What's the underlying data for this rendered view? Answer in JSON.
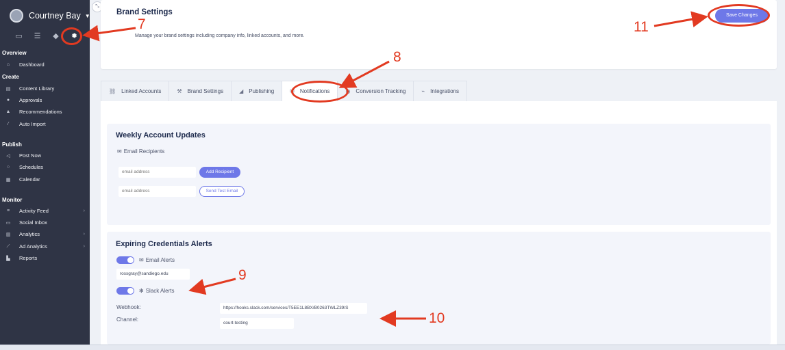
{
  "sidebar": {
    "profile_name": "Courtney Bay",
    "top_icons": [
      "monitor-icon",
      "list-icon",
      "bell-icon",
      "gear-icon"
    ],
    "sections": {
      "overview": "Overview",
      "create": "Create",
      "publish": "Publish",
      "monitor": "Monitor"
    },
    "items": {
      "dashboard": "Dashboard",
      "content_library": "Content Library",
      "approvals": "Approvals",
      "recommendations": "Recommendations",
      "auto_import": "Auto Import",
      "post_now": "Post Now",
      "schedules": "Schedules",
      "calendar": "Calendar",
      "activity_feed": "Activity Feed",
      "social_inbox": "Social Inbox",
      "analytics": "Analytics",
      "ad_analytics": "Ad Analytics",
      "reports": "Reports"
    }
  },
  "header": {
    "title": "Brand Settings",
    "subtitle": "Manage your brand settings including company info, linked accounts, and more.",
    "save_label": "Save Changes"
  },
  "tabs": {
    "linked_accounts": "Linked Accounts",
    "brand_settings": "Brand Settings",
    "publishing": "Publishing",
    "notifications": "Notifications",
    "conversion_tracking": "Conversion Tracking",
    "integrations": "Integrations",
    "active": "Notifications"
  },
  "weekly": {
    "title": "Weekly Account Updates",
    "recipients_label": "Email Recipients",
    "email_placeholder_1": "email address",
    "email_placeholder_2": "email address",
    "add_recipient": "Add Recipient",
    "send_test": "Send Test Email"
  },
  "expiring": {
    "title": "Expiring Credentials Alerts",
    "email_alerts_label": "Email Alerts",
    "email_alerts_on": true,
    "email_value": "rossgray@sandiego.edu",
    "slack_alerts_label": "Slack Alerts",
    "slack_alerts_on": true,
    "webhook_label": "Webhook:",
    "webhook_value": "https://hooks.slack.com/services/T5EE1L8BX/B0263TWLZ39/S",
    "channel_label": "Channel:",
    "channel_value": "court-testing"
  },
  "annotations": {
    "n7": "7",
    "n8": "8",
    "n9": "9",
    "n10": "10",
    "n11": "11",
    "color": "#e23a21"
  },
  "colors": {
    "sidebar_bg": "#2f3445",
    "accent": "#6e78e8",
    "page_bg": "#eef1f6"
  }
}
